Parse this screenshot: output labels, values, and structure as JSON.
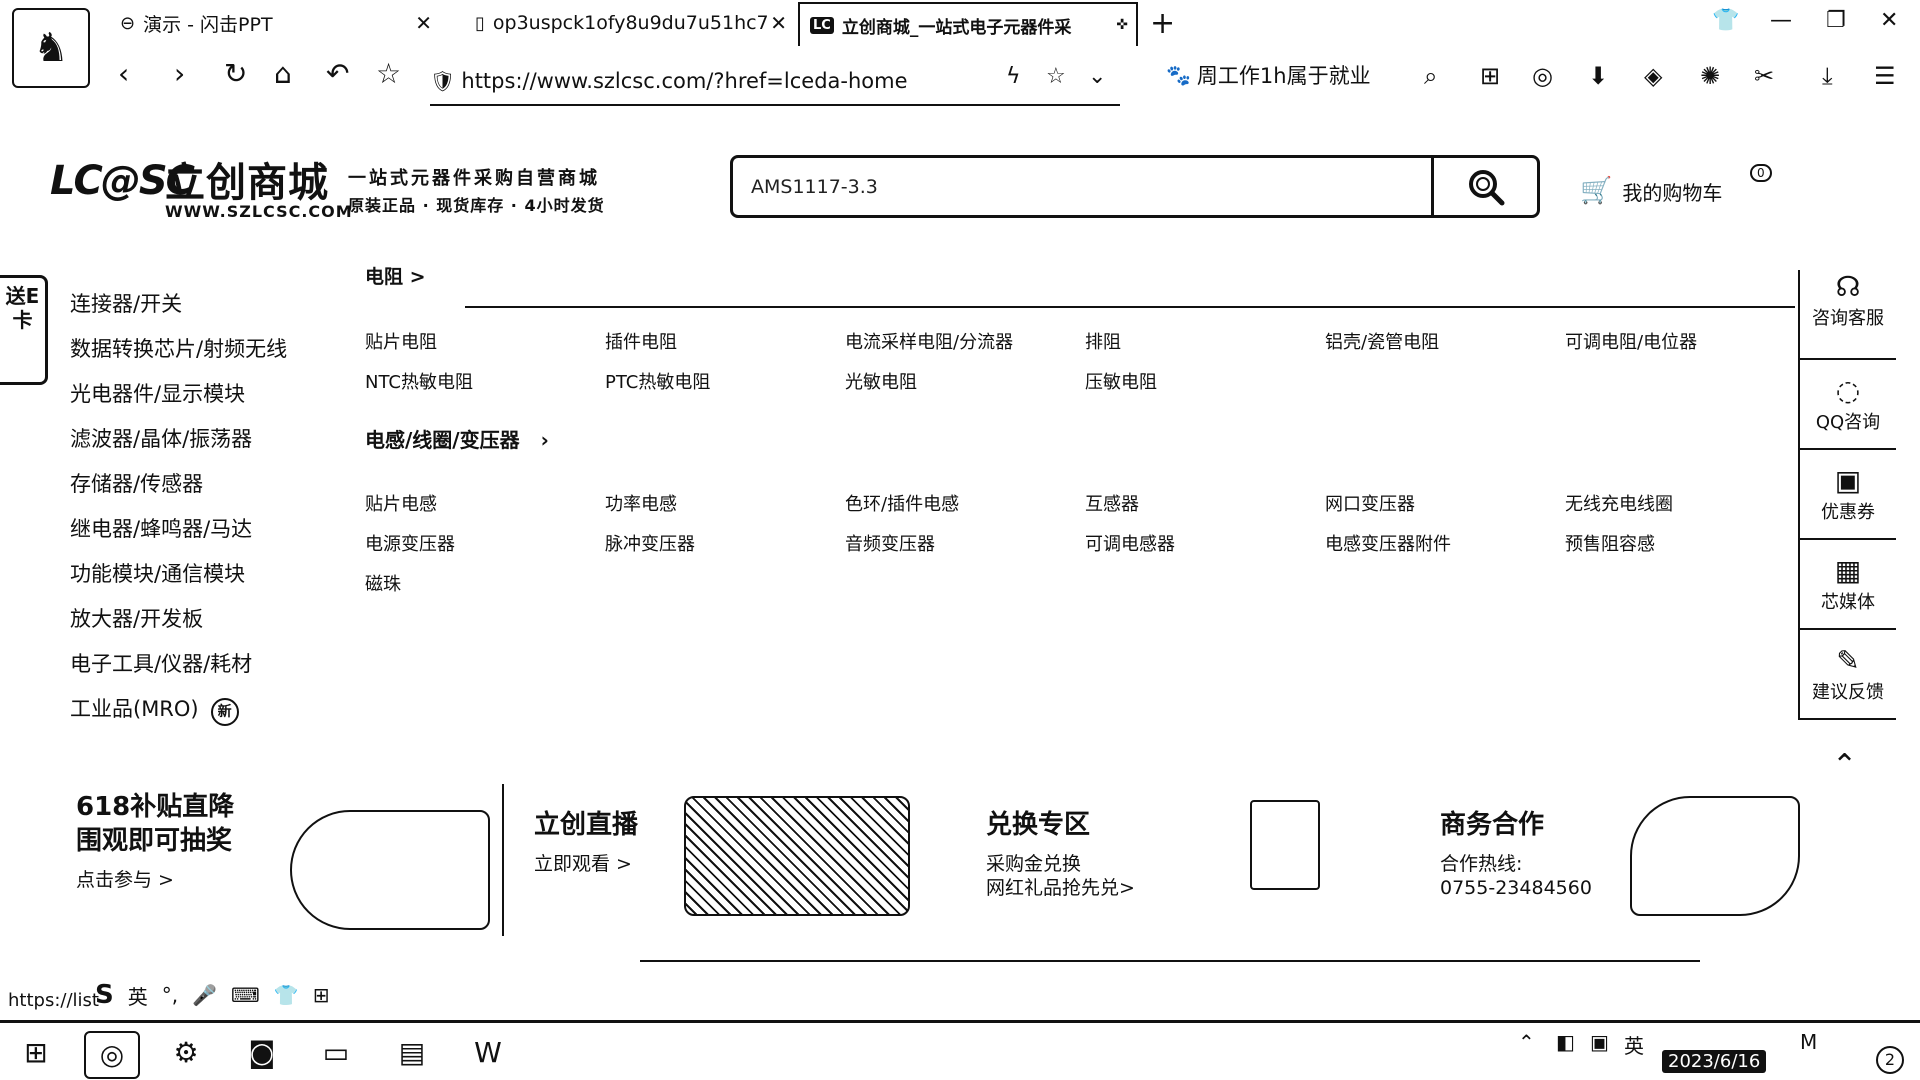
{
  "browser": {
    "tabs": [
      {
        "label": "演示 - 闪击PPT",
        "icon": "link-icon"
      },
      {
        "label": "op3uspck1ofy8u9du7u51hc7",
        "icon": "doc-icon"
      },
      {
        "label": "立创商城_一站式电子元器件采",
        "icon": "lcsc-icon"
      }
    ],
    "new_tab": "+",
    "url": "https://www.szlcsc.com/?href=lceda-home",
    "bookmark": "周工作1h属于就业"
  },
  "header": {
    "brand": "LC@SC",
    "company": "立创商城",
    "site_url": "WWW.SZLCSC.COM",
    "slogan1": "一站式元器件采购自营商城",
    "slogan2": "原装正品 · 现货库存 · 4小时发货",
    "search_value": "AMS1117-3.3",
    "cart_label": "我的购物车",
    "cart_count": "0"
  },
  "float_left": "送E卡",
  "categories": [
    "连接器/开关",
    "数据转换芯片/射频无线",
    "光电器件/显示模块",
    "滤波器/晶体/振荡器",
    "存储器/传感器",
    "继电器/蜂鸣器/马达",
    "功能模块/通信模块",
    "放大器/开发板",
    "电子工具/仪器/耗材",
    "工业品(MRO)"
  ],
  "category_new_badge": "新",
  "mega": {
    "cut_title": "电阻 >",
    "resistor_items": [
      "贴片电阻",
      "插件电阻",
      "电流采样电阻/分流器",
      "排阻",
      "铝壳/瓷管电阻",
      "可调电阻/电位器",
      "NTC热敏电阻",
      "PTC热敏电阻",
      "光敏电阻",
      "压敏电阻"
    ],
    "inductor_title": "电感/线圈/变压器",
    "inductor_items": [
      "贴片电感",
      "功率电感",
      "色环/插件电感",
      "互感器",
      "网口变压器",
      "无线充电线圈",
      "电源变压器",
      "脉冲变压器",
      "音频变压器",
      "可调电感器",
      "电感变压器附件",
      "预售阻容感",
      "磁珠"
    ]
  },
  "right_bar": [
    {
      "label": "咨询客服",
      "icon": "headset-icon"
    },
    {
      "label": "QQ咨询",
      "icon": "qq-icon"
    },
    {
      "label": "优惠券",
      "icon": "coupon-icon"
    },
    {
      "label": "芯媒体",
      "icon": "qr-icon"
    },
    {
      "label": "建议反馈",
      "icon": "edit-icon"
    }
  ],
  "promos": [
    {
      "title1": "618补贴直降",
      "title2": "围观即可抽奖",
      "sub": "点击参与 >"
    },
    {
      "title1": "立创直播",
      "sub": "立即观看 >"
    },
    {
      "title1": "兑换专区",
      "sub1": "采购金兑换",
      "sub2": "网红礼品抢先兑>"
    },
    {
      "title1": "商务合作",
      "sub1": "合作热线:",
      "sub2": "0755-23484560"
    }
  ],
  "status_url": "https://list",
  "ime": {
    "lang": "英",
    "punct": "°,"
  },
  "tray": {
    "lang": "英",
    "date": "2023/6/16",
    "notif": "2"
  }
}
